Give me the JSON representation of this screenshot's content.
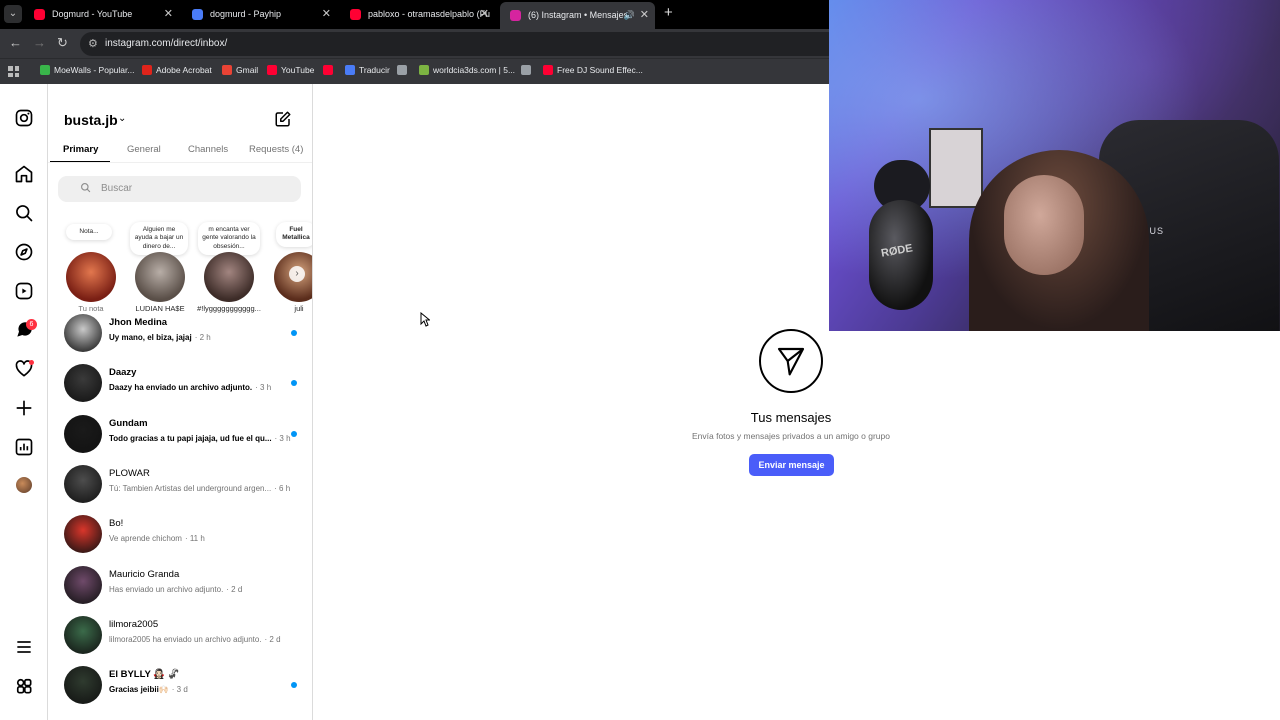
{
  "browser": {
    "tabs": [
      {
        "title": "Dogmurd - YouTube",
        "favicon_color": "#ff0033"
      },
      {
        "title": "dogmurd - Payhip",
        "favicon_color": "#4a7cf7"
      },
      {
        "title": "pabloxo - otramasdelpablo (Fu",
        "favicon_color": "#ff0033"
      },
      {
        "title": "(6) Instagram • Mensajes",
        "favicon_color": "#d6249f"
      }
    ],
    "url": "instagram.com/direct/inbox/",
    "bookmarks": [
      {
        "label": "MoeWalls - Popular...",
        "color": "#39b54a"
      },
      {
        "label": "Adobe Acrobat",
        "color": "#e0241b"
      },
      {
        "label": "Gmail",
        "color": "#ea4335"
      },
      {
        "label": "YouTube",
        "color": "#ff0033"
      },
      {
        "label": "",
        "color": "#ff0033"
      },
      {
        "label": "Traducir",
        "color": "#4a7cf7"
      },
      {
        "label": "",
        "color": "#9aa0a6"
      },
      {
        "label": "worldcia3ds.com | 5...",
        "color": "#7cb342"
      },
      {
        "label": "",
        "color": "#9aa0a6"
      },
      {
        "label": "Free DJ Sound Effec...",
        "color": "#ff0033"
      }
    ]
  },
  "rail": {
    "notifications_badge": "6"
  },
  "inbox": {
    "username": "busta.jb",
    "tabs": [
      "Primary",
      "General",
      "Channels",
      "Requests (4)"
    ],
    "search_placeholder": "Buscar",
    "notes": [
      {
        "bubble": "Nota...",
        "name": "Tu nota",
        "color": "#c0392b"
      },
      {
        "bubble": "Alguien me ayuda a bajar un dinero de...",
        "name": "LUDIAN HA$E",
        "color": "#8a7f77"
      },
      {
        "bubble": "m encanta ver gente valorando la obsesión...",
        "name": "#!lyggggggggggg...",
        "color": "#6b5b55"
      },
      {
        "bubble": "Fuel Metallica",
        "name": "juli",
        "color": "#a0522d"
      }
    ],
    "conversations": [
      {
        "name": "Jhon Medina",
        "preview": "Uy mano, el biza, jajaj",
        "time": "· 2 h",
        "unread": true,
        "color": "#c9c9c9"
      },
      {
        "name": "Daazy",
        "preview": "Daazy ha enviado un archivo adjunto.",
        "time": "· 3 h",
        "unread": true,
        "color": "#3a3a3a"
      },
      {
        "name": "Gundam",
        "preview": "Todo gracias a tu papi jajaja, ud fue el qu...",
        "time": "· 3 h",
        "unread": true,
        "color": "#1a1a1a"
      },
      {
        "name": "PLOWAR",
        "preview": "Tú: Tambien Artistas del underground argen...",
        "time": "· 6 h",
        "unread": false,
        "color": "#4d4d4d"
      },
      {
        "name": "Bo!",
        "preview": "Ve aprende chichom",
        "time": "· 11 h",
        "unread": false,
        "color": "#d9362b"
      },
      {
        "name": "Mauricio Granda",
        "preview": "Has enviado un archivo adjunto.",
        "time": "· 2 d",
        "unread": false,
        "color": "#6f4a6a"
      },
      {
        "name": "lilmora2005",
        "preview": "lilmora2005 ha enviado un archivo adjunto.",
        "time": "· 2 d",
        "unread": false,
        "color": "#3b6b4a"
      },
      {
        "name": "El BYLLY 🧛🏻‍♀️ 🦨",
        "preview": "Gracias jeibii🙌🏻",
        "time": "· 3 d",
        "unread": true,
        "color": "#2f3b2f"
      }
    ]
  },
  "empty_state": {
    "title": "Tus mensajes",
    "subtitle": "Envía fotos y mensajes privados a un amigo o grupo",
    "button": "Enviar mensaje"
  },
  "webcam": {
    "mic_label": "RØDE",
    "chair_label": "OPTIMUS"
  }
}
